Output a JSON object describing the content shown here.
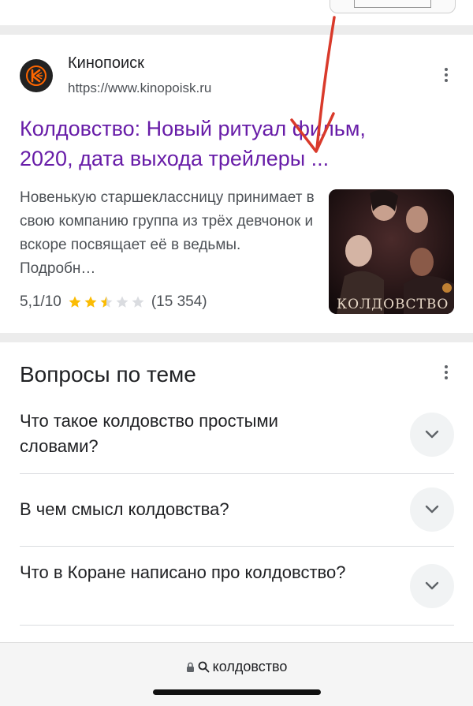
{
  "result": {
    "site_name": "Кинопоиск",
    "url": "https://www.kinopoisk.ru",
    "title": "Колдовство: Новый ритуал фильм, 2020, дата выхода трейлеры ...",
    "snippet": "Новенькую старшеклассницу принимает в свою компанию группа из трёх девчонок и вскоре посвящает её в ведьмы. Подробн…",
    "rating": "5,1/10",
    "rating_value": 2.5,
    "rating_max": 5,
    "votes": "(15 354)",
    "thumbnail_caption": "КОЛДОВСТВО",
    "favicon_icon": "kinopoisk-logo-icon",
    "accent_color": "#ff6600"
  },
  "paa": {
    "heading": "Вопросы по теме",
    "questions": [
      {
        "text": "Что такое колдовство простыми словами?"
      },
      {
        "text": "В чем смысл колдовства?"
      },
      {
        "text": "Что в Коране написано про колдовство?"
      }
    ]
  },
  "address_bar": {
    "query": "колдовство",
    "icons": [
      "lock-icon",
      "search-icon"
    ]
  },
  "colors": {
    "title_visited": "#681da8",
    "annotation_arrow": "#d93a2b",
    "star": "#fbbc04"
  }
}
